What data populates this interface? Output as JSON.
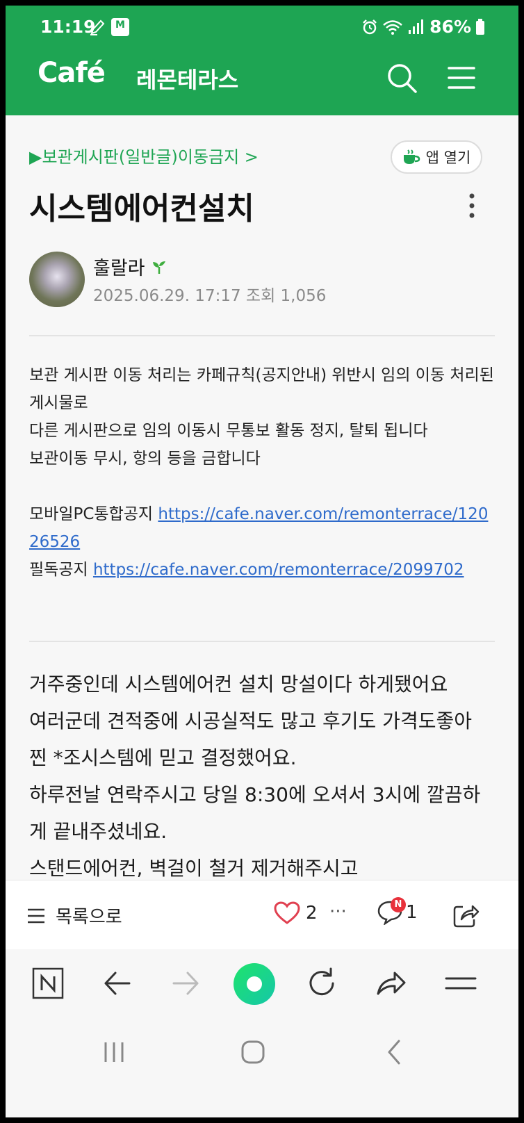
{
  "status_bar": {
    "time": "11:19",
    "app_badge": "M",
    "battery": "86%"
  },
  "header": {
    "logo": "Café",
    "cafe_name": "레몬테라스"
  },
  "post": {
    "board": "▶보관게시판(일반글)이동금지 >",
    "open_app_label": "앱 열기",
    "title": "시스템에어컨설치",
    "author": "훌랄라",
    "date": "2025.06.29. 17:17",
    "views_label": "조회",
    "views": "1,056"
  },
  "notice": {
    "line1": "보관 게시판 이동 처리는 카페규칙(공지안내) 위반시 임의 이동 처리된 게시물로",
    "line2": "다른 게시판으로 임의 이동시 무통보 활동 정지, 탈퇴 됩니다",
    "line3": "보관이동 무시, 항의 등을 금합니다",
    "mobile_label": "모바일PC통합공지 ",
    "mobile_url": "https://cafe.naver.com/remonterrace/12026526",
    "required_label": "필독공지 ",
    "required_url": "https://cafe.naver.com/remonterrace/2099702"
  },
  "body": {
    "p1": "거주중인데 시스템에어컨 설치 망설이다 하게됐어요",
    "p2": "여러군데 견적중에 시공실적도 많고 후기도 가격도좋아 찐 *조시스템에 믿고 결정했어요.",
    "p3": "하루전날 연락주시고 당일 8:30에 오셔서 3시에 깔끔하게 끝내주셨네요.",
    "p4": "스탠드에어컨, 벽걸이 철거 제거해주시고"
  },
  "action_bar": {
    "list_label": "목록으로",
    "likes": "2",
    "more": "···",
    "comment_badge": "N",
    "comments": "1"
  },
  "colors": {
    "brand_green": "#1ea553",
    "link_blue": "#2f6bcb",
    "like_red": "#e04050"
  }
}
